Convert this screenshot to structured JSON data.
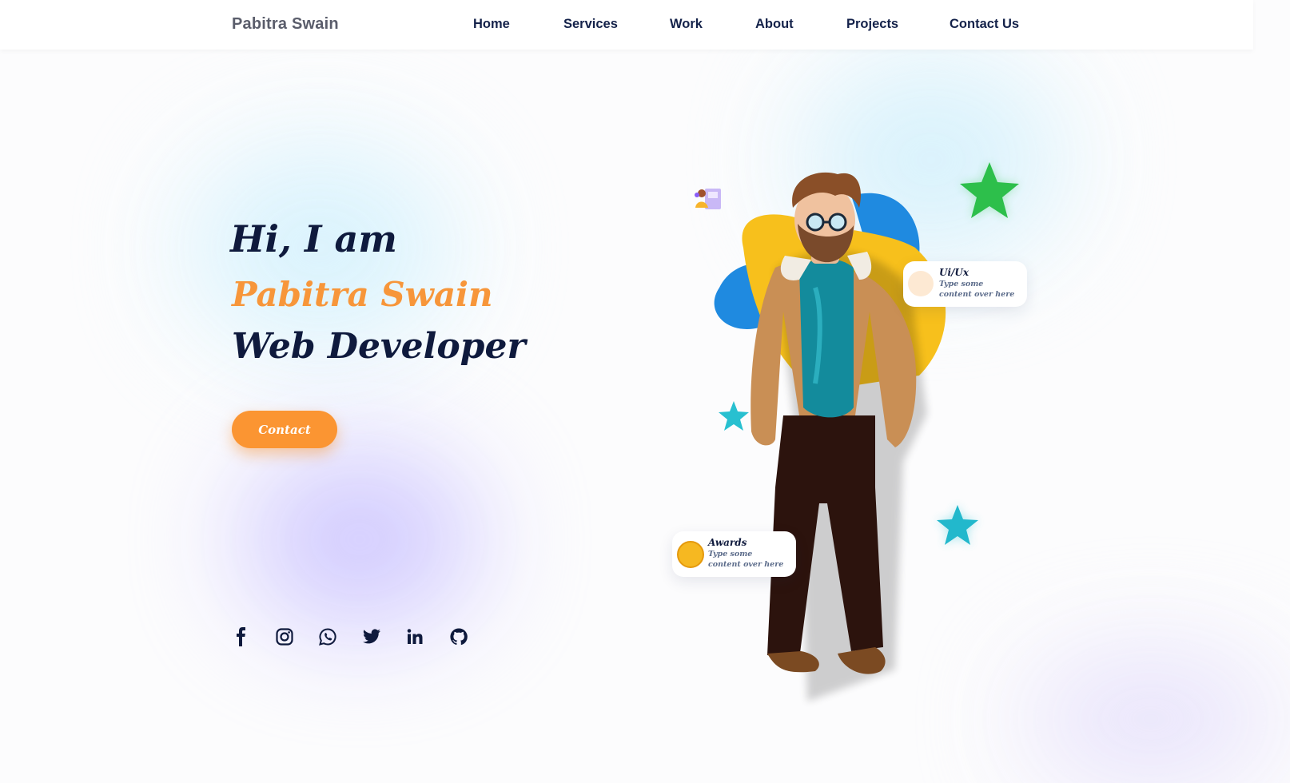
{
  "header": {
    "logo": "Pabitra Swain",
    "nav": [
      {
        "label": "Home"
      },
      {
        "label": "Services"
      },
      {
        "label": "Work"
      },
      {
        "label": "About"
      },
      {
        "label": "Projects"
      },
      {
        "label": "Contact Us"
      }
    ]
  },
  "hero": {
    "greeting": "Hi, I am",
    "name": "Pabitra Swain",
    "role": "Web Developer",
    "contact_label": "Contact",
    "accent_color": "#fb9532",
    "text_color": "#0f1a3d"
  },
  "cards": {
    "uiux": {
      "title": "Ui/Ux",
      "desc": "Type some content over here"
    },
    "awards": {
      "title": "Awards",
      "desc": "Type some content over here"
    }
  },
  "social": [
    {
      "icon": "facebook-icon"
    },
    {
      "icon": "instagram-icon"
    },
    {
      "icon": "whatsapp-icon"
    },
    {
      "icon": "twitter-icon"
    },
    {
      "icon": "linkedin-icon"
    },
    {
      "icon": "github-icon"
    }
  ]
}
